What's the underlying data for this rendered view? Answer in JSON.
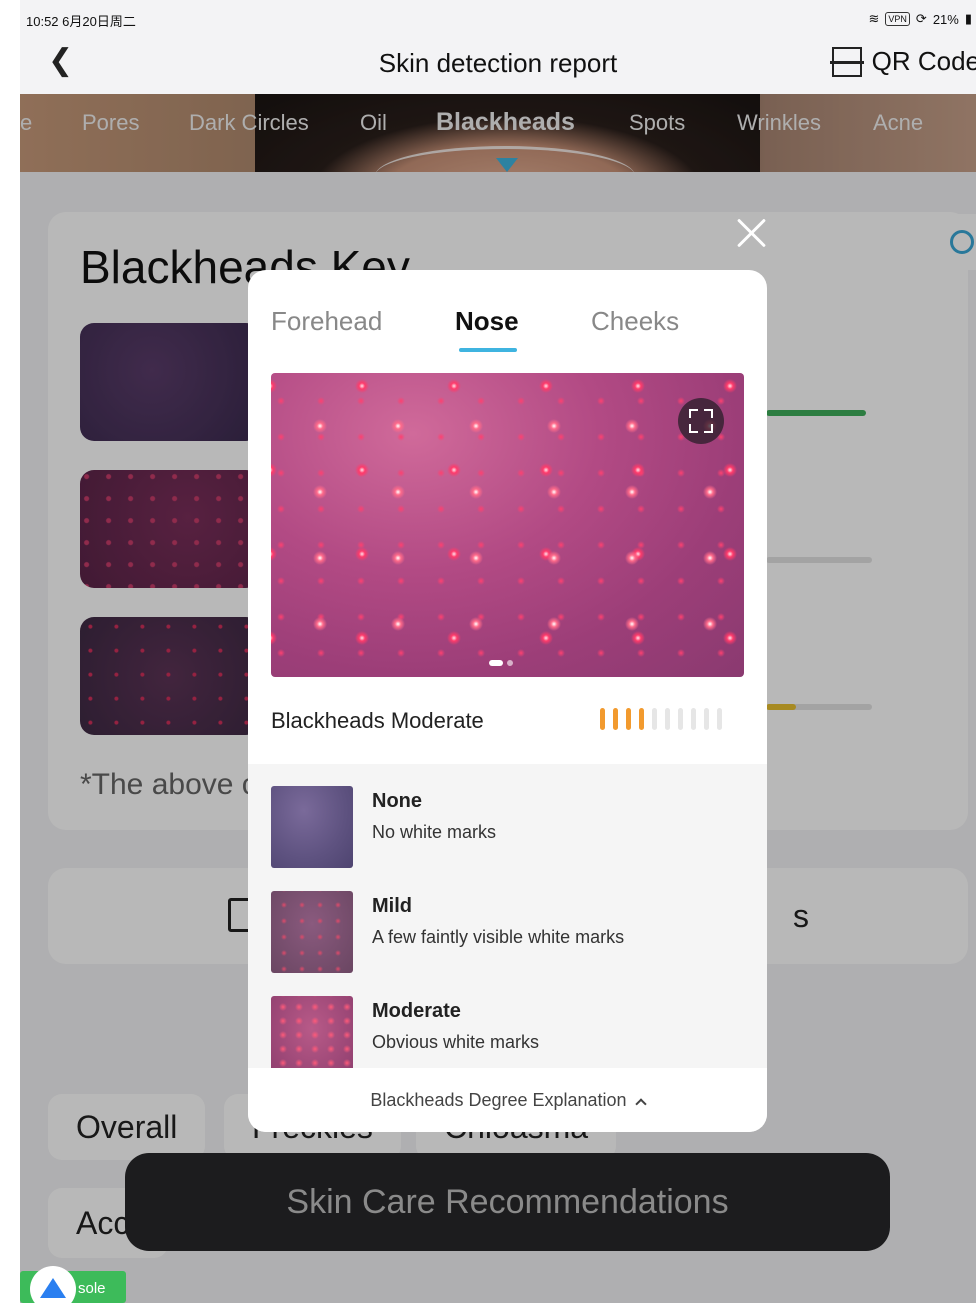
{
  "status_bar": {
    "time_date": "10:52  6月20日周二",
    "vpn": "VPN",
    "battery": "21%"
  },
  "header": {
    "back_icon": "chevron-left-icon",
    "title": "Skin detection report",
    "qr_label": "QR Code",
    "qr_icon": "qr-scan-icon"
  },
  "categories": [
    {
      "label": "e"
    },
    {
      "label": "Pores"
    },
    {
      "label": "Dark Circles"
    },
    {
      "label": "Oil"
    },
    {
      "label": "Blackheads",
      "active": true
    },
    {
      "label": "Spots"
    },
    {
      "label": "Wrinkles"
    },
    {
      "label": "Acne"
    }
  ],
  "background_card": {
    "title": "Blackheads Key",
    "note": "*The above c",
    "section_suffix": "s"
  },
  "pills": [
    {
      "label": "Overall",
      "active": true
    },
    {
      "label": "Freckles"
    },
    {
      "label": "Chloasma"
    }
  ],
  "pill_acc": "Acc",
  "modal": {
    "tabs": [
      {
        "label": "Forehead"
      },
      {
        "label": "Nose",
        "active": true
      },
      {
        "label": "Cheeks"
      }
    ],
    "status_text": "Blackheads Moderate",
    "level": {
      "filled": 4,
      "total": 10,
      "color": "#f29a2e"
    },
    "degrees": [
      {
        "name": "None",
        "desc": "No white marks"
      },
      {
        "name": "Mild",
        "desc": "A few faintly visible white marks"
      },
      {
        "name": "Moderate",
        "desc": "Obvious white marks"
      }
    ],
    "footer_label": "Blackheads Degree Explanation",
    "accent_color": "#3fb4e0"
  },
  "cta_label": "Skin Care Recommendations",
  "console_label": "sole"
}
